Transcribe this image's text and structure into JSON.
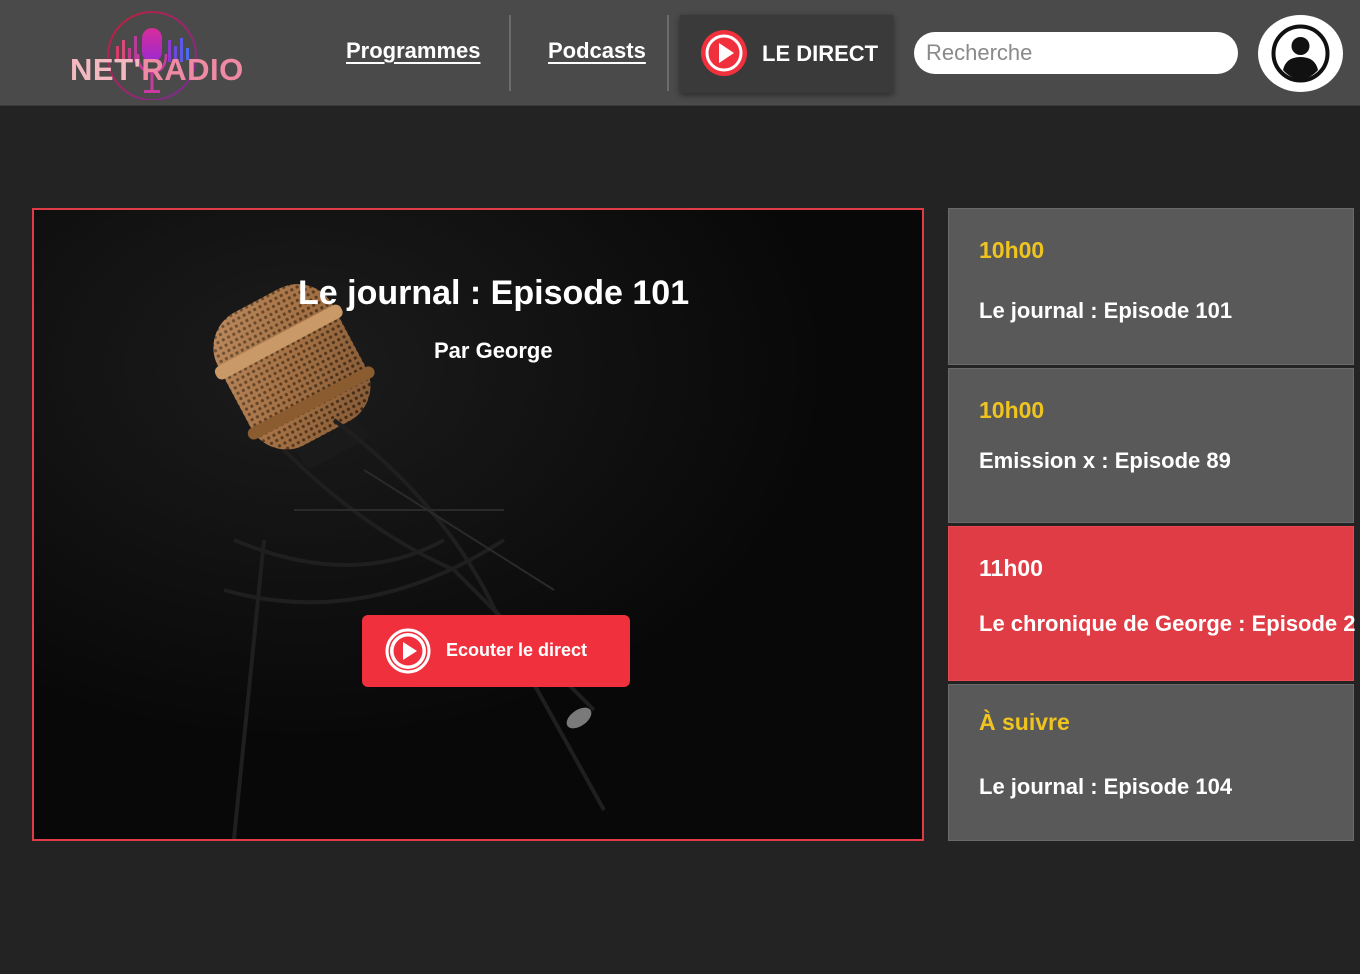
{
  "header": {
    "logo": {
      "part1": "NET'",
      "part2": "RADIO"
    },
    "nav": [
      {
        "label": "Programmes"
      },
      {
        "label": "Podcasts"
      }
    ],
    "direct_label": "LE DIRECT",
    "search": {
      "placeholder": "Recherche",
      "value": ""
    },
    "icons": {
      "play": "play-circle-icon",
      "account": "user-account-icon"
    }
  },
  "hero": {
    "title": "Le journal : Episode 101",
    "author": "Par George",
    "listen_label": "Ecouter le direct"
  },
  "schedule": [
    {
      "time": "10h00",
      "title": "Le journal : Episode 101",
      "active": false
    },
    {
      "time": "10h00",
      "title": "Emission x : Episode 89",
      "active": false
    },
    {
      "time": "11h00",
      "title": "Le chronique de George : Episode 2",
      "active": true
    },
    {
      "time": "À suivre",
      "title": "Le journal : Episode 104",
      "active": false
    }
  ],
  "colors": {
    "accent_red": "#f0313d",
    "time_yellow": "#f0c420",
    "header_bg": "#4a4a4a",
    "page_bg": "#232323"
  }
}
